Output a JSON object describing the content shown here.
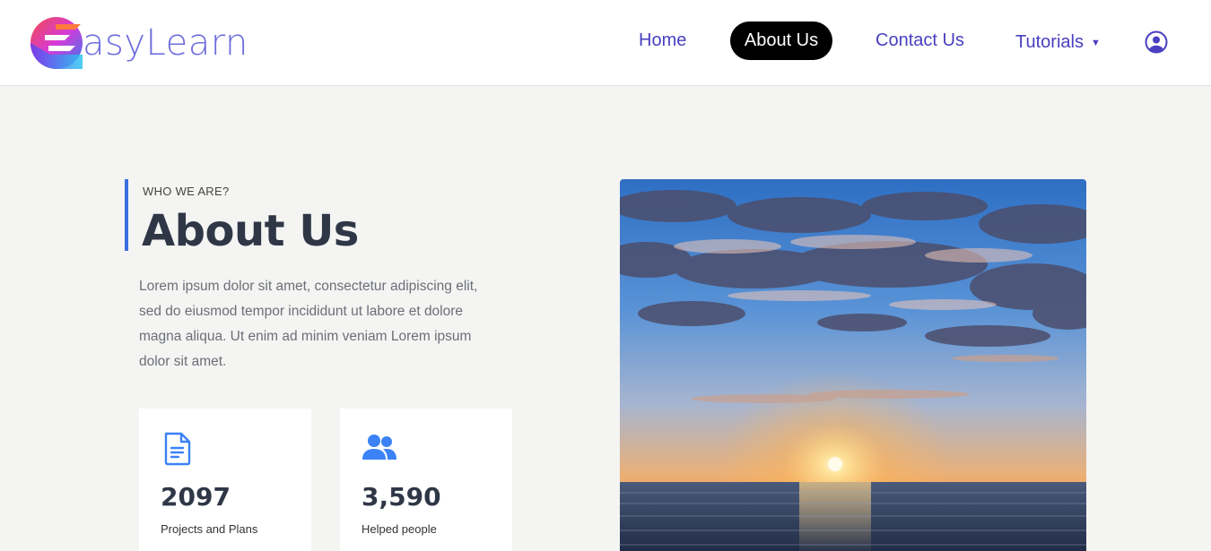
{
  "brand": {
    "name": "asyLearn",
    "logo_icon": "easylearn-logo-mark"
  },
  "nav": {
    "home": "Home",
    "about": "About Us",
    "contact": "Contact Us",
    "tutorials": "Tutorials",
    "tutorials_caret": "▼",
    "user_icon": "user-circle-icon"
  },
  "colors": {
    "accent": "#3b6fe0",
    "nav_text": "#4a3fc0",
    "active_nav_bg": "#000000",
    "heading": "#2f3747"
  },
  "hero": {
    "eyebrow": "WHO WE ARE?",
    "title": "About Us",
    "paragraph": "Lorem ipsum dolor sit amet, consectetur adipiscing elit, sed do eiusmod tempor incididunt ut labore et dolore magna aliqua. Ut enim ad minim veniam Lorem ipsum dolor sit amet."
  },
  "stats": [
    {
      "icon": "document-icon",
      "value": "2097",
      "label": "Projects and Plans"
    },
    {
      "icon": "users-icon",
      "value": "3,590",
      "label": "Helped people"
    }
  ],
  "image": {
    "description_icon": "sunset-photo"
  }
}
